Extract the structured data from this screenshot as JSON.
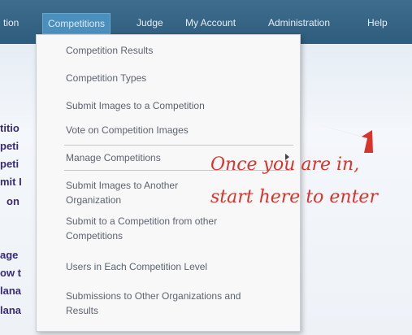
{
  "navbar": {
    "items": [
      {
        "label": "tion"
      },
      {
        "label": "Competitions"
      },
      {
        "label": "Judge"
      },
      {
        "label": "My Account"
      },
      {
        "label": "Administration"
      },
      {
        "label": "Help"
      }
    ]
  },
  "background_text": [
    "titio",
    "peti",
    "peti",
    "mit I",
    "on",
    "age",
    "ow t",
    "lana",
    "lana"
  ],
  "menu": {
    "items": [
      {
        "label": "Competition Results"
      },
      {
        "label": "Competition Types"
      },
      {
        "label": "Submit Images to a Competition"
      },
      {
        "label": "Vote on Competition Images"
      },
      {
        "label": "Manage Competitions"
      },
      {
        "label": "Submit Images to Another Organization"
      },
      {
        "label": "Submit to a Competition from other Competitions"
      },
      {
        "label": "Users in Each Competition Level"
      },
      {
        "label": "Submissions to Other Organizations and Results"
      }
    ]
  },
  "annotation": {
    "line1": "Once you are in,",
    "line2": "start here to enter",
    "color": "#d9342b"
  },
  "colors": {
    "navbar": "#2f5c7c",
    "active_tab": "#4b8fbd",
    "menu_bg": "#f8f8f8",
    "menu_text": "#5c6470"
  }
}
